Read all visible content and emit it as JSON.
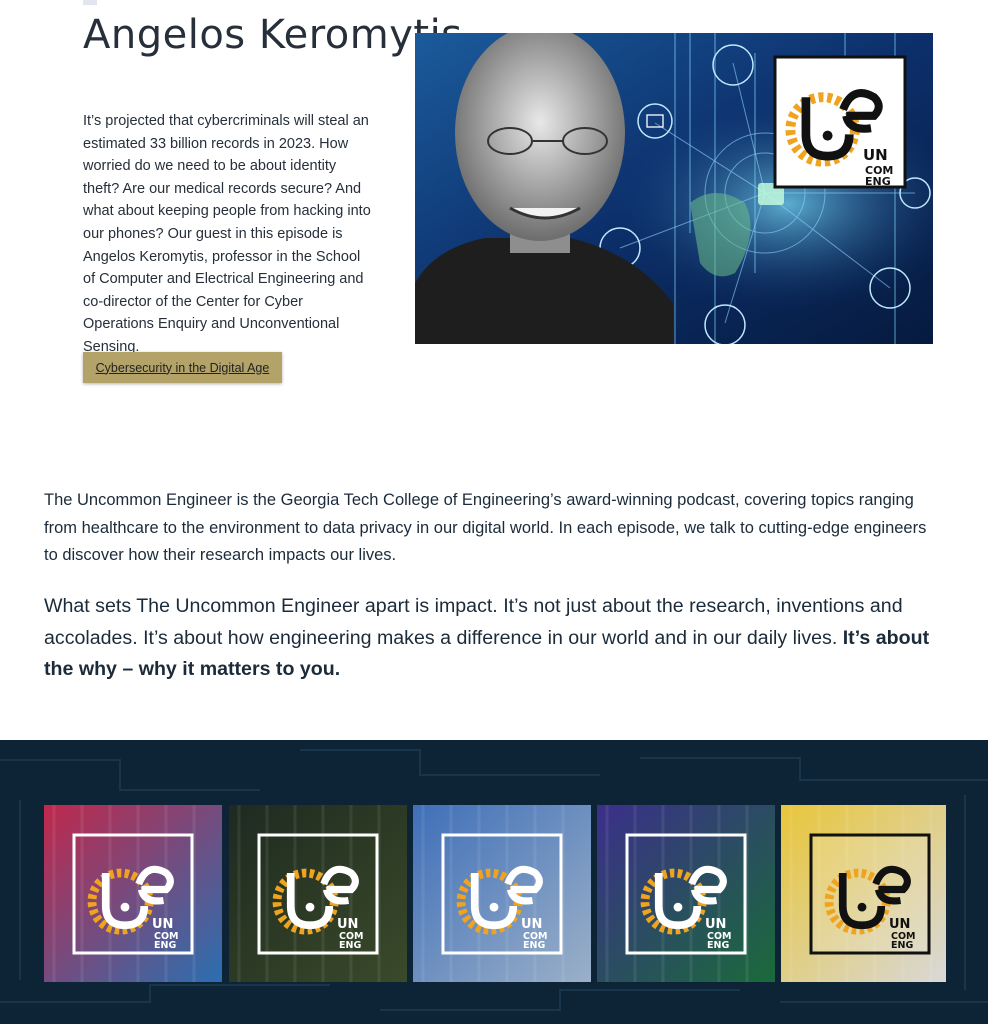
{
  "guest": {
    "name": "Angelos Keromytis",
    "description": "It’s projected that cybercriminals will steal an estimated 33 billion records in 2023. How worried do we need to be about identity theft? Are our medical records secure? And what about keeping people from hacking into our phones? Our guest in this episode is Angelos Keromytis, professor in the School of Computer and Electrical Engineering and co-director of the Center for Cyber Operations Enquiry and Unconventional Sensing.",
    "episode_button_label": "Cybersecurity in the Digital Age"
  },
  "logo": {
    "text_un": "UN",
    "text_com": "COM",
    "text_eng": "ENG"
  },
  "about": {
    "intro": "The Uncommon Engineer is the Georgia Tech College of Engineering’s award-winning podcast, covering topics ranging from healthcare to the environment to data privacy in our digital world. In each episode, we talk to cutting-edge engineers to discover how their research impacts our lives.",
    "impact_lead": "What sets The Uncommon Engineer apart is impact. It’s not just about the research, inventions and accolades. It’s about how engineering makes a difference in our world and in our daily lives. ",
    "impact_bold": "It’s about the why – why it matters to you."
  },
  "episode_thumbnails": [
    {
      "theme": "data-center",
      "colors": [
        "#c0284c",
        "#2a6fb0"
      ]
    },
    {
      "theme": "cyber-locks",
      "colors": [
        "#1e2a20",
        "#3a4a2a"
      ]
    },
    {
      "theme": "delivery-drone",
      "colors": [
        "#3f6fb8",
        "#9bb0c8"
      ]
    },
    {
      "theme": "virus",
      "colors": [
        "#3b2f8a",
        "#1a6a3a"
      ]
    },
    {
      "theme": "flower",
      "colors": [
        "#e8c63a",
        "#d8d8d8"
      ]
    }
  ],
  "colors": {
    "gold": "#b3a369",
    "navy": "#0d2336",
    "gear_orange": "#f0a31f"
  }
}
